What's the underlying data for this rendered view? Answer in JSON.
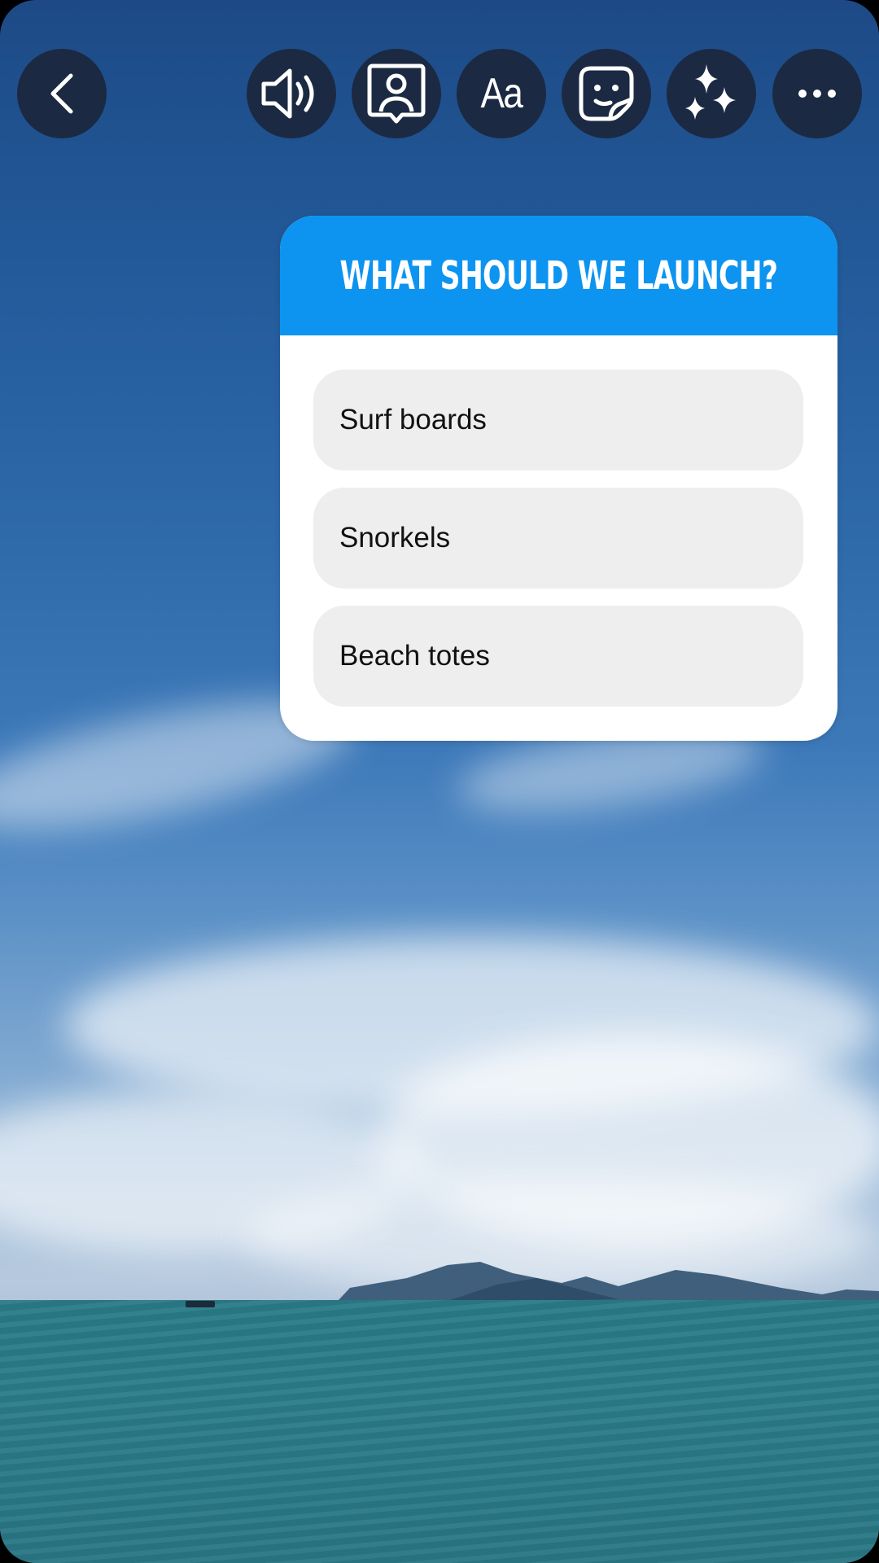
{
  "toolbar": {
    "back": {
      "icon": "chevron-left-icon",
      "label": "Back"
    },
    "buttons": [
      {
        "icon": "speaker-icon",
        "label": "Sound"
      },
      {
        "icon": "person-frame-icon",
        "label": "Mention"
      },
      {
        "icon": "text-icon",
        "label": "Aa"
      },
      {
        "icon": "sticker-icon",
        "label": "Stickers"
      },
      {
        "icon": "sparkles-icon",
        "label": "Effects"
      },
      {
        "icon": "more-icon",
        "label": "More"
      }
    ]
  },
  "poll": {
    "question": "WHAT SHOULD WE LAUNCH?",
    "header_color": "#0d94f0",
    "options": [
      {
        "label": "Surf boards"
      },
      {
        "label": "Snorkels"
      },
      {
        "label": "Beach totes"
      }
    ]
  },
  "background": {
    "description": "Photo of blue sky with clouds over turquoise sea with distant island and a small boat"
  }
}
